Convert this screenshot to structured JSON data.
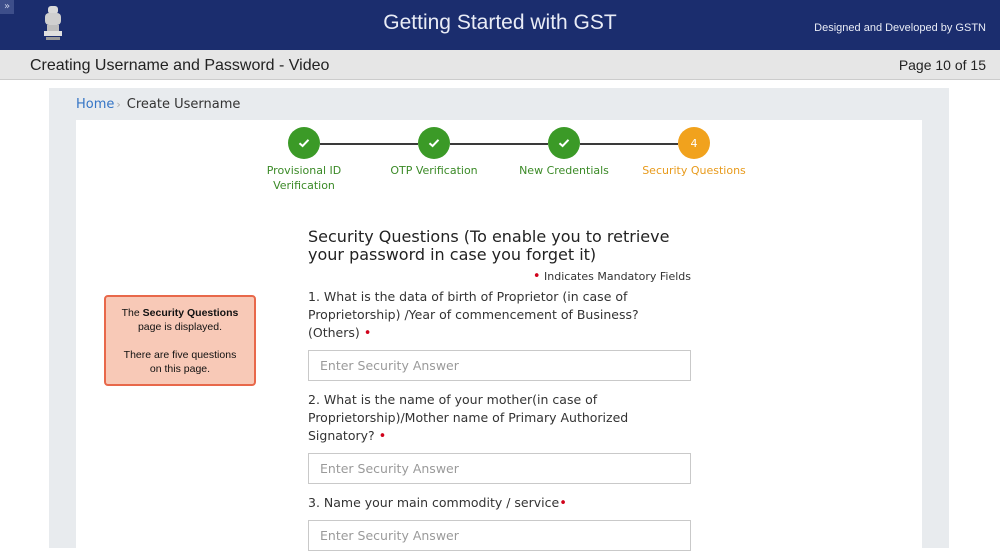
{
  "header": {
    "title": "Getting Started with GST",
    "credit": "Designed and Developed by GSTN",
    "corner_glyph": "»"
  },
  "subheader": {
    "lesson_title": "Creating Username and Password - Video",
    "page_label": "Page 10 of 15"
  },
  "breadcrumb": {
    "home": "Home",
    "separator": "›",
    "current": "Create Username"
  },
  "steps": [
    {
      "label_line1": "Provisional ID",
      "label_line2": "Verification",
      "icon": "check-icon",
      "state": "done"
    },
    {
      "label_line1": "OTP Verification",
      "label_line2": "",
      "icon": "check-icon",
      "state": "done"
    },
    {
      "label_line1": "New Credentials",
      "label_line2": "",
      "icon": "check-icon",
      "state": "done"
    },
    {
      "number": "4",
      "label_line1": "Security Questions",
      "label_line2": "",
      "state": "active"
    }
  ],
  "form": {
    "heading": "Security Questions (To enable you to retrieve your password in case you forget it)",
    "mandatory_note": "Indicates Mandatory Fields",
    "mandatory_marker": "•",
    "questions": [
      {
        "text": "1. What is the data of birth of Proprietor (in case of Proprietorship) /Year of commencement of Business? (Others)",
        "placeholder": "Enter Security Answer"
      },
      {
        "text": "2. What is the name of your mother(in case of Proprietorship)/Mother name of Primary Authorized Signatory?",
        "placeholder": "Enter Security Answer"
      },
      {
        "text": "3. Name your main commodity / service",
        "placeholder": "Enter Security Answer"
      }
    ]
  },
  "callout": {
    "line1_prefix": "The ",
    "line1_bold": "Security Questions",
    "line2": "page is displayed.",
    "line3": "There are five questions",
    "line4": "on this page."
  },
  "colors": {
    "header_bg": "#1b2d6e",
    "step_done": "#3b9a27",
    "step_active": "#f1a21d",
    "mandatory_dot": "#d0021b",
    "callout_bg": "#f8c9b7",
    "callout_border": "#e8684a",
    "link": "#3575c6"
  }
}
